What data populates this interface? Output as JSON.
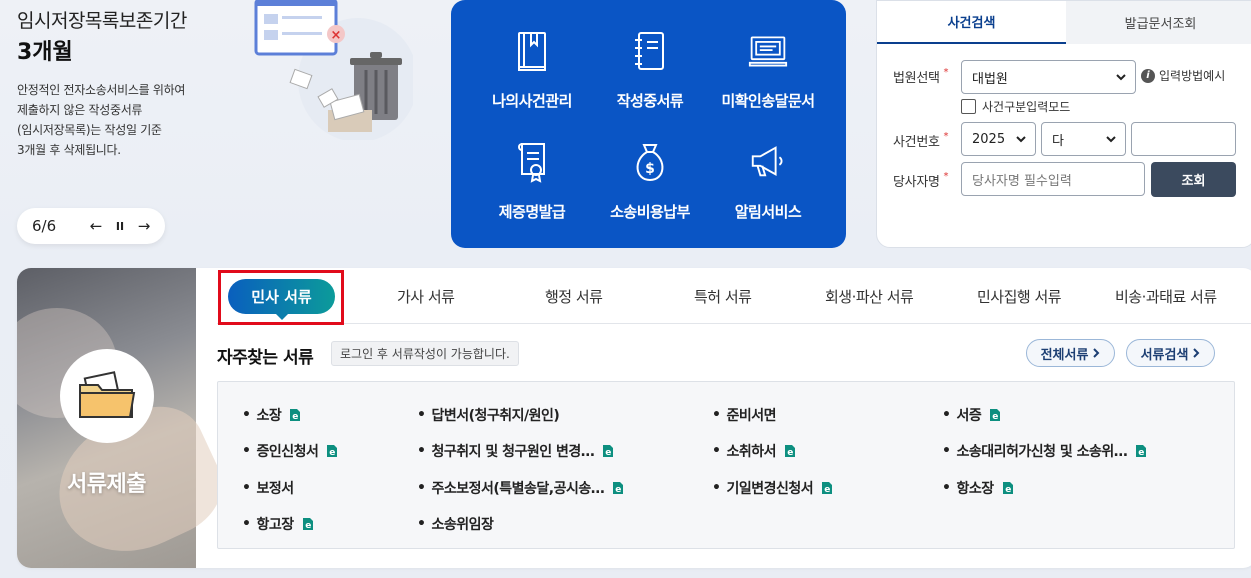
{
  "banner": {
    "title": "임시저장목록보존기간",
    "period": "3개월",
    "desc_lines": [
      "안정적인 전자소송서비스를 위하여",
      "제출하지 않은 작성중서류",
      "(임시저장목록)는 작성일 기준",
      "3개월 후 삭제됩니다."
    ],
    "pager": {
      "count": "6/6",
      "prev": "←",
      "pause": "II",
      "next": "→"
    }
  },
  "quick_menu": [
    {
      "label": "나의사건관리",
      "icon": "book-icon"
    },
    {
      "label": "작성중서류",
      "icon": "notebook-icon"
    },
    {
      "label": "미확인송달문서",
      "icon": "monitor-icon"
    },
    {
      "label": "제증명발급",
      "icon": "certificate-icon"
    },
    {
      "label": "소송비용납부",
      "icon": "money-bag-icon"
    },
    {
      "label": "알림서비스",
      "icon": "megaphone-icon"
    }
  ],
  "search": {
    "tabs": [
      "사건검색",
      "발급문서조회"
    ],
    "court_label": "법원선택",
    "court_value": "대법원",
    "help": "입력방법예시",
    "mode_checkbox": "사건구분입력모드",
    "case_label": "사건번호",
    "year_value": "2025",
    "type_value": "다",
    "number_value": "",
    "party_label": "당사자명",
    "party_placeholder": "당사자명 필수입력",
    "submit": "조회",
    "required_mark": "*"
  },
  "docs": {
    "side_title": "서류제출",
    "tabs": [
      "민사 서류",
      "가사 서류",
      "행정 서류",
      "특허 서류",
      "회생·파산 서류",
      "민사집행 서류",
      "비송·과태료 서류"
    ],
    "freq_title": "자주찾는 서류",
    "freq_note": "로그인 후 서류작성이 가능합니다.",
    "all_docs": "전체서류",
    "doc_search": "서류검색",
    "items": [
      {
        "name": "소장",
        "e": true
      },
      {
        "name": "답변서(청구취지/원인)",
        "e": false
      },
      {
        "name": "준비서면",
        "e": false
      },
      {
        "name": "서증",
        "e": true
      },
      {
        "name": "증인신청서",
        "e": true
      },
      {
        "name": "청구취지 및 청구원인 변경…",
        "e": true
      },
      {
        "name": "소취하서",
        "e": true
      },
      {
        "name": "소송대리허가신청 및 소송위…",
        "e": true
      },
      {
        "name": "보정서",
        "e": false
      },
      {
        "name": "주소보정서(특별송달,공시송…",
        "e": true
      },
      {
        "name": "기일변경신청서",
        "e": true
      },
      {
        "name": "항소장",
        "e": true
      },
      {
        "name": "항고장",
        "e": true
      },
      {
        "name": "소송위임장",
        "e": false
      }
    ]
  },
  "colors": {
    "primary_blue": "#0a55c5",
    "dark_button": "#3b4a5e",
    "highlight_red": "#e10b1b",
    "tab_gradient_start": "#0a5fbe",
    "tab_gradient_end": "#0c9b9a"
  }
}
